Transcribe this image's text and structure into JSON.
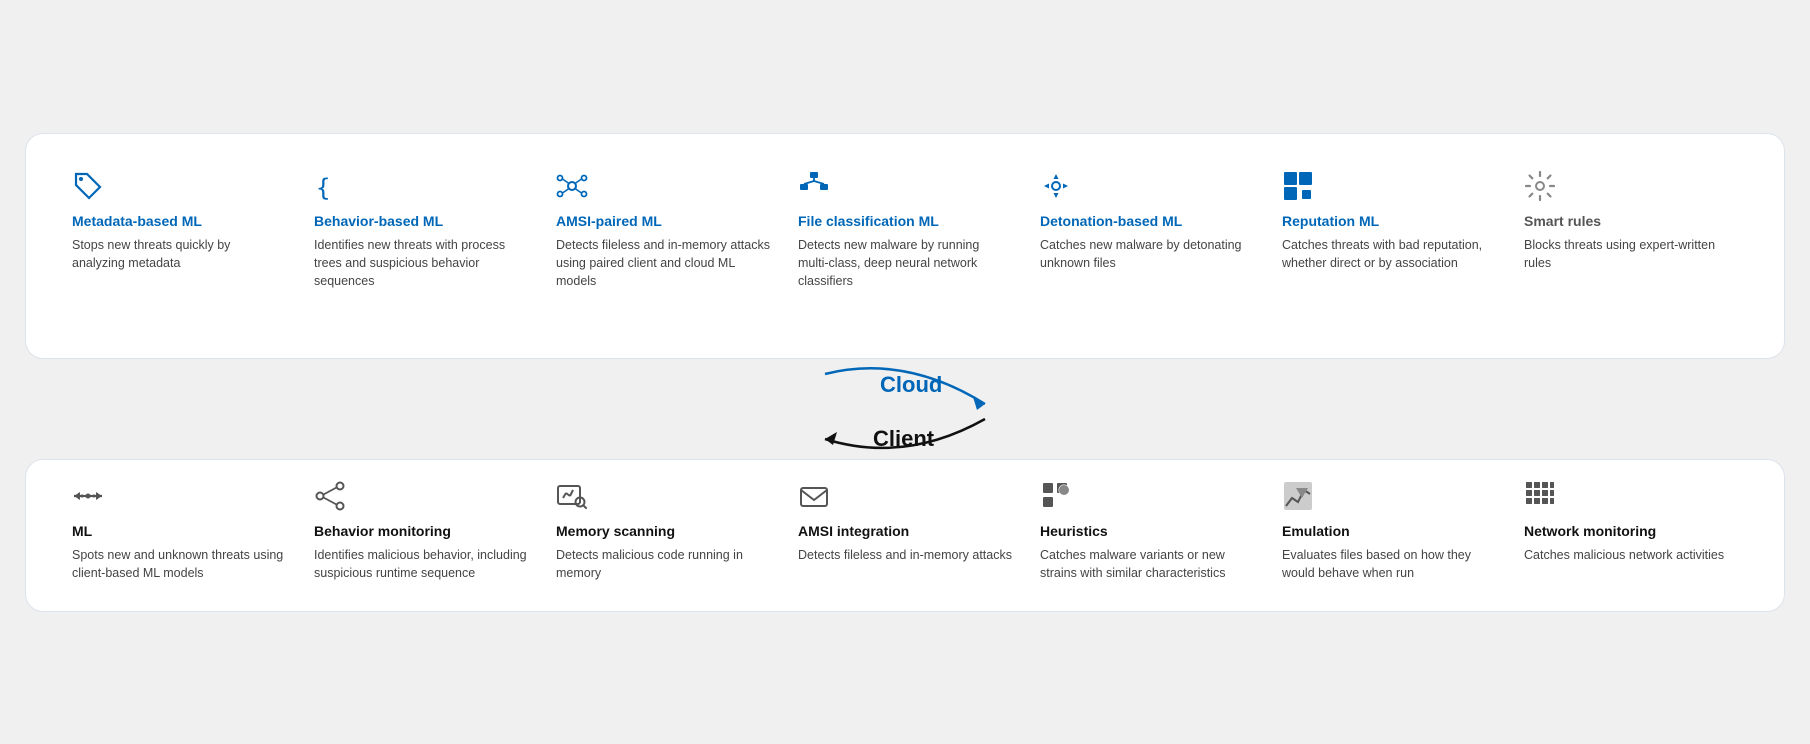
{
  "cloud_panel": {
    "items": [
      {
        "id": "metadata-ml",
        "title": "Metadata-based ML",
        "desc": "Stops new threats quickly by analyzing metadata",
        "icon": "tag"
      },
      {
        "id": "behavior-ml",
        "title": "Behavior-based ML",
        "desc": "Identifies new threats with process trees and suspicious behavior sequences",
        "icon": "braces"
      },
      {
        "id": "amsi-ml",
        "title": "AMSI-paired ML",
        "desc": "Detects fileless and in-memory attacks using paired client and cloud ML models",
        "icon": "network"
      },
      {
        "id": "file-ml",
        "title": "File classification ML",
        "desc": "Detects new malware by running multi-class, deep neural network classifiers",
        "icon": "hierarchy"
      },
      {
        "id": "detonation-ml",
        "title": "Detonation-based ML",
        "desc": "Catches new malware by detonating unknown files",
        "icon": "move"
      },
      {
        "id": "reputation-ml",
        "title": "Reputation ML",
        "desc": "Catches threats with bad reputation, whether direct or by association",
        "icon": "squares"
      },
      {
        "id": "smart-rules",
        "title": "Smart rules",
        "desc": "Blocks threats using expert-written rules",
        "icon": "gear"
      }
    ]
  },
  "middle": {
    "cloud_label": "Cloud",
    "client_label": "Client"
  },
  "client_panel": {
    "items": [
      {
        "id": "ml-client",
        "title": "ML",
        "desc": "Spots new and unknown threats using client-based ML models",
        "icon": "arrows-lr"
      },
      {
        "id": "behavior-monitoring",
        "title": "Behavior monitoring",
        "desc": "Identifies malicious behavior, including suspicious runtime sequence",
        "icon": "share"
      },
      {
        "id": "memory-scanning",
        "title": "Memory scanning",
        "desc": "Detects malicious code running in memory",
        "icon": "chart-search"
      },
      {
        "id": "amsi-integration",
        "title": "AMSI integration",
        "desc": "Detects fileless and in-memory attacks",
        "icon": "envelope"
      },
      {
        "id": "heuristics",
        "title": "Heuristics",
        "desc": "Catches malware variants or new strains with similar characteristics",
        "icon": "dots-grid"
      },
      {
        "id": "emulation",
        "title": "Emulation",
        "desc": "Evaluates files based on how they would behave when run",
        "icon": "mountain-chart"
      },
      {
        "id": "network-monitoring",
        "title": "Network monitoring",
        "desc": "Catches malicious network activities",
        "icon": "grid-blocks"
      }
    ]
  }
}
